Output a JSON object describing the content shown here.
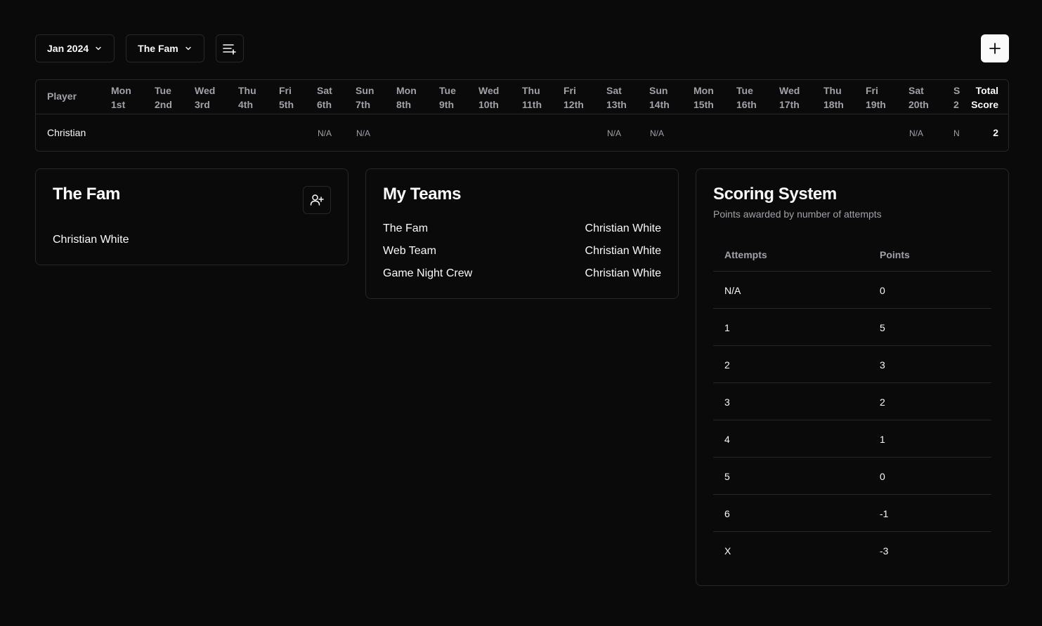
{
  "toolbar": {
    "month": "Jan 2024",
    "team": "The Fam"
  },
  "scoreboard": {
    "player_header": "Player",
    "total_header": [
      "Total",
      "Score"
    ],
    "days": [
      [
        "Mon",
        "1st"
      ],
      [
        "Tue",
        "2nd"
      ],
      [
        "Wed",
        "3rd"
      ],
      [
        "Thu",
        "4th"
      ],
      [
        "Fri",
        "5th"
      ],
      [
        "Sat",
        "6th"
      ],
      [
        "Sun",
        "7th"
      ],
      [
        "Mon",
        "8th"
      ],
      [
        "Tue",
        "9th"
      ],
      [
        "Wed",
        "10th"
      ],
      [
        "Thu",
        "11th"
      ],
      [
        "Fri",
        "12th"
      ],
      [
        "Sat",
        "13th"
      ],
      [
        "Sun",
        "14th"
      ],
      [
        "Mon",
        "15th"
      ],
      [
        "Tue",
        "16th"
      ],
      [
        "Wed",
        "17th"
      ],
      [
        "Thu",
        "18th"
      ],
      [
        "Fri",
        "19th"
      ],
      [
        "Sat",
        "20th"
      ],
      [
        "S",
        "2"
      ]
    ],
    "rows": [
      {
        "player": "Christian",
        "cells": [
          "",
          "",
          "",
          "",
          "",
          "N/A",
          "N/A",
          "",
          "",
          "",
          "",
          "",
          "N/A",
          "N/A",
          "",
          "",
          "",
          "",
          "",
          "N/A",
          "N"
        ],
        "total": "2"
      }
    ]
  },
  "fam_card": {
    "title": "The Fam",
    "members": [
      "Christian White"
    ]
  },
  "teams_card": {
    "title": "My Teams",
    "teams": [
      {
        "name": "The Fam",
        "owner": "Christian White"
      },
      {
        "name": "Web Team",
        "owner": "Christian White"
      },
      {
        "name": "Game Night Crew",
        "owner": "Christian White"
      }
    ]
  },
  "scoring_card": {
    "title": "Scoring System",
    "subtitle": "Points awarded by number of attempts",
    "headers": [
      "Attempts",
      "Points"
    ],
    "rows": [
      [
        "N/A",
        "0"
      ],
      [
        "1",
        "5"
      ],
      [
        "2",
        "3"
      ],
      [
        "3",
        "2"
      ],
      [
        "4",
        "1"
      ],
      [
        "5",
        "0"
      ],
      [
        "6",
        "-1"
      ],
      [
        "X",
        "-3"
      ]
    ]
  }
}
